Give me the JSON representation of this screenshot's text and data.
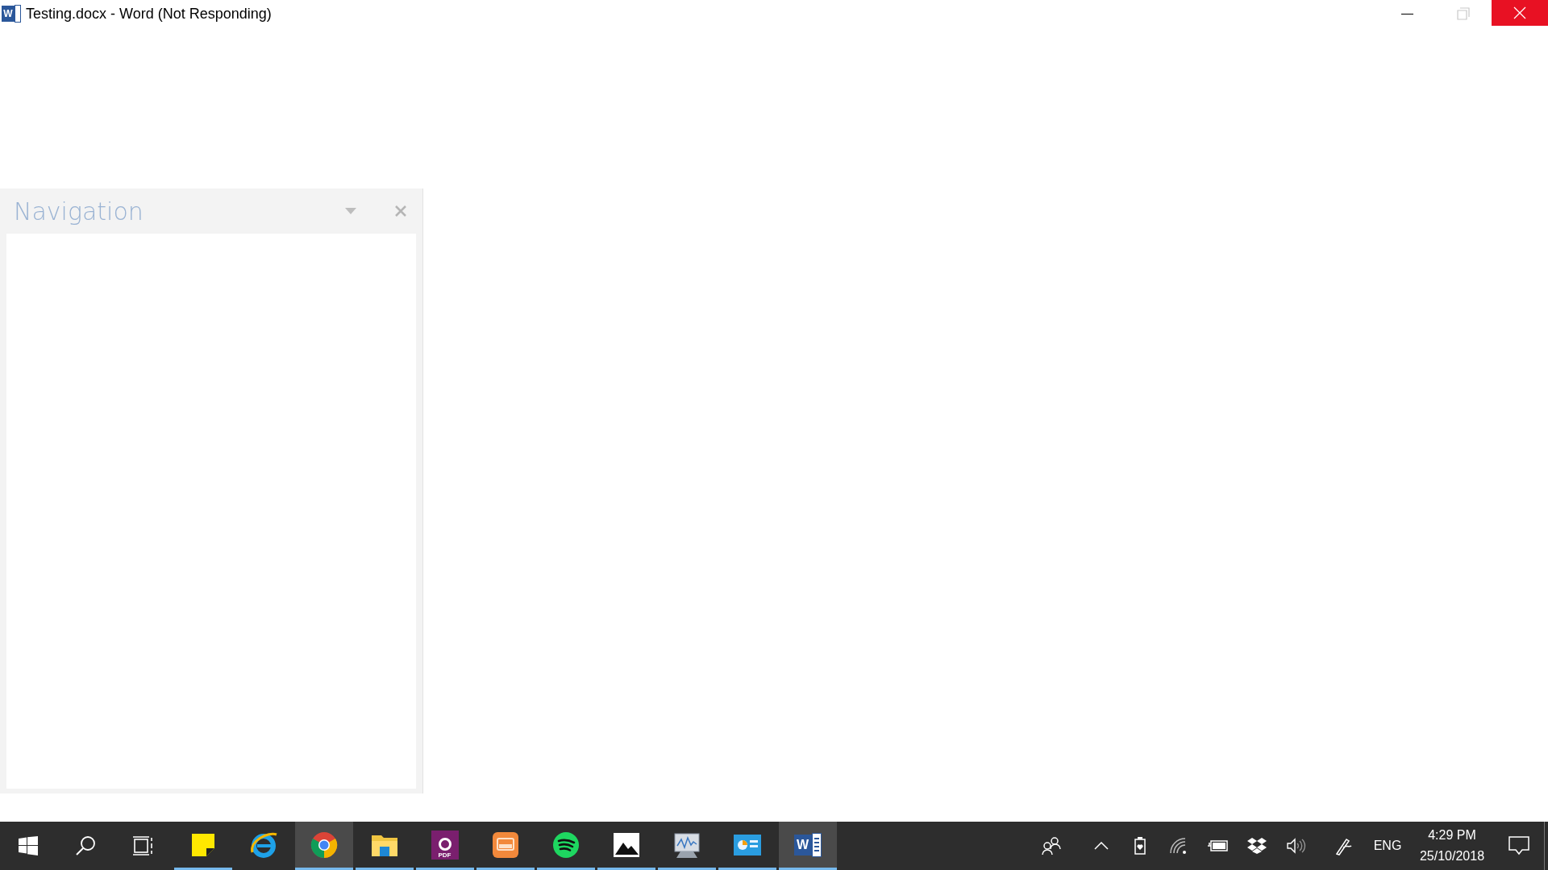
{
  "window": {
    "title": "Testing.docx - Word (Not Responding)",
    "icon_letter": "W"
  },
  "navigation_pane": {
    "title": "Navigation"
  },
  "taskbar": {
    "apps": [
      {
        "kind": "sticky",
        "running": true,
        "highlighted": false
      },
      {
        "kind": "ie",
        "running": false,
        "highlighted": false
      },
      {
        "kind": "chrome",
        "running": true,
        "highlighted": true
      },
      {
        "kind": "folder",
        "running": true,
        "highlighted": false
      },
      {
        "kind": "pdf",
        "running": true,
        "highlighted": false,
        "badge": "PDF"
      },
      {
        "kind": "slides",
        "running": true,
        "highlighted": false
      },
      {
        "kind": "music",
        "running": true,
        "highlighted": false
      },
      {
        "kind": "photos",
        "running": true,
        "highlighted": false
      },
      {
        "kind": "monitor",
        "running": true,
        "highlighted": false
      },
      {
        "kind": "card",
        "running": true,
        "highlighted": false
      },
      {
        "kind": "word",
        "running": true,
        "highlighted": true,
        "badge": "W"
      }
    ],
    "language": "ENG",
    "time": "4:29 PM",
    "date": "25/10/2018"
  }
}
